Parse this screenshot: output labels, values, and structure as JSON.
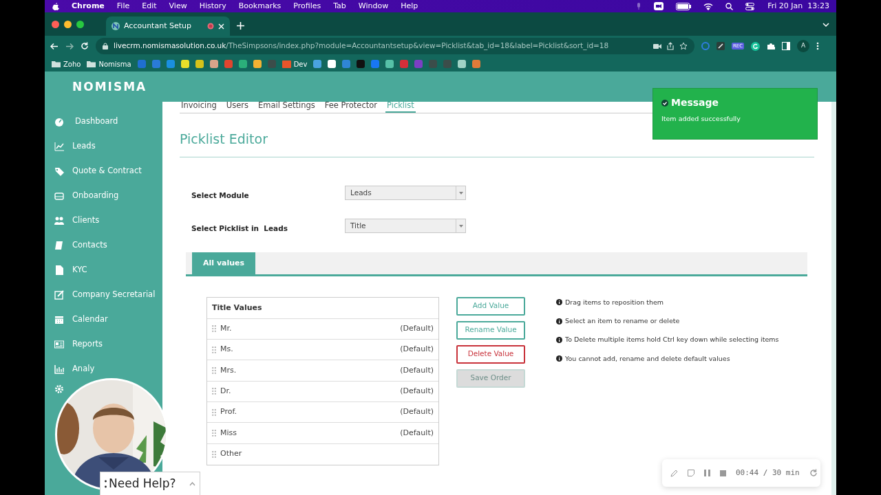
{
  "menubar": {
    "app": "Chrome",
    "menus": [
      "File",
      "Edit",
      "View",
      "History",
      "Bookmarks",
      "Profiles",
      "Tab",
      "Window",
      "Help"
    ],
    "clock": "Fri 20 Jan  13:23"
  },
  "browser": {
    "tab_title": "Accountant Setup",
    "url_host": "livecrm.nomismasolution.co.uk",
    "url_path": "/TheSimpsons/index.php?module=Accountantsetup&view=Picklist&tab_id=18&label=Picklist&sort_id=18",
    "rec_badge": "REC",
    "profile_initial": "A",
    "bookmarks": [
      {
        "kind": "folder",
        "label": "Zoho"
      },
      {
        "kind": "folder",
        "label": "Nomisma"
      },
      {
        "kind": "icon",
        "color": "#1f6fd1"
      },
      {
        "kind": "icon",
        "color": "#2a7bd8"
      },
      {
        "kind": "icon",
        "color": "#1a8fe0"
      },
      {
        "kind": "icon",
        "color": "#e8e02a"
      },
      {
        "kind": "icon",
        "color": "#d6c21a"
      },
      {
        "kind": "icon",
        "color": "#d9a48a"
      },
      {
        "kind": "icon",
        "color": "#e0452f"
      },
      {
        "kind": "icon",
        "color": "#2bb07a"
      },
      {
        "kind": "icon",
        "color": "#f2b233"
      },
      {
        "kind": "icon",
        "color": "#3b4d4a"
      },
      {
        "kind": "site",
        "label": "Dev",
        "color": "#e8552b"
      },
      {
        "kind": "icon",
        "color": "#4aa3df"
      },
      {
        "kind": "icon",
        "color": "#ffffff"
      },
      {
        "kind": "icon",
        "color": "#2f86d6"
      },
      {
        "kind": "icon",
        "color": "#111111"
      },
      {
        "kind": "icon",
        "color": "#1877f2"
      },
      {
        "kind": "icon",
        "color": "#56c1a8"
      },
      {
        "kind": "icon",
        "color": "#d32f3a"
      },
      {
        "kind": "icon",
        "color": "#7b3fc4"
      },
      {
        "kind": "icon",
        "color": "#3b4d4a"
      },
      {
        "kind": "icon",
        "color": "#3b4d4a"
      },
      {
        "kind": "icon",
        "color": "#9fd3c6"
      },
      {
        "kind": "icon",
        "color": "#e07b39"
      }
    ]
  },
  "app": {
    "logo": "NOMISMA",
    "sidebar": [
      "Dashboard",
      "Leads",
      "Quote & Contract",
      "Onboarding",
      "Clients",
      "Contacts",
      "KYC",
      "Company Secretarial",
      "Calendar",
      "Reports",
      "Analy"
    ],
    "settings_tabs": [
      {
        "label": "Invoicing",
        "selected": false
      },
      {
        "label": "Users",
        "selected": false
      },
      {
        "label": "Email Settings",
        "selected": false
      },
      {
        "label": "Fee Protector",
        "selected": false
      },
      {
        "label": "Picklist",
        "selected": true
      }
    ],
    "heading": "Picklist Editor",
    "form": [
      {
        "label": "Select Module",
        "value": "Leads"
      },
      {
        "label": "Select Picklist in  Leads",
        "value": "Title"
      }
    ],
    "value_tabs": [
      {
        "label": "All values",
        "selected": true
      }
    ],
    "values_table": {
      "heading": "Title Values",
      "rows": [
        {
          "label": "Mr.",
          "note": "(Default)"
        },
        {
          "label": "Ms.",
          "note": "(Default)"
        },
        {
          "label": "Mrs.",
          "note": "(Default)"
        },
        {
          "label": "Dr.",
          "note": "(Default)"
        },
        {
          "label": "Prof.",
          "note": "(Default)"
        },
        {
          "label": "Miss",
          "note": "(Default)"
        },
        {
          "label": "Other"
        }
      ]
    },
    "actions": [
      {
        "label": "Add Value",
        "kind": "primary",
        "disabled": false
      },
      {
        "label": "Rename Value",
        "kind": "primary",
        "disabled": false
      },
      {
        "label": "Delete Value",
        "kind": "danger",
        "disabled": false
      },
      {
        "label": "Save Order",
        "kind": "primary",
        "disabled": true
      }
    ],
    "tips": [
      "Drag items to reposition them",
      "Select an item to rename or delete",
      "To Delete multiple items hold Ctrl key down while selecting items",
      "You cannot add, rename and delete default values"
    ],
    "toast": {
      "title": "Message",
      "text": "Item added successfully"
    }
  },
  "help_widget": {
    "label": "Need Help?"
  },
  "recorder": {
    "time": "00:44 / 30 min"
  }
}
